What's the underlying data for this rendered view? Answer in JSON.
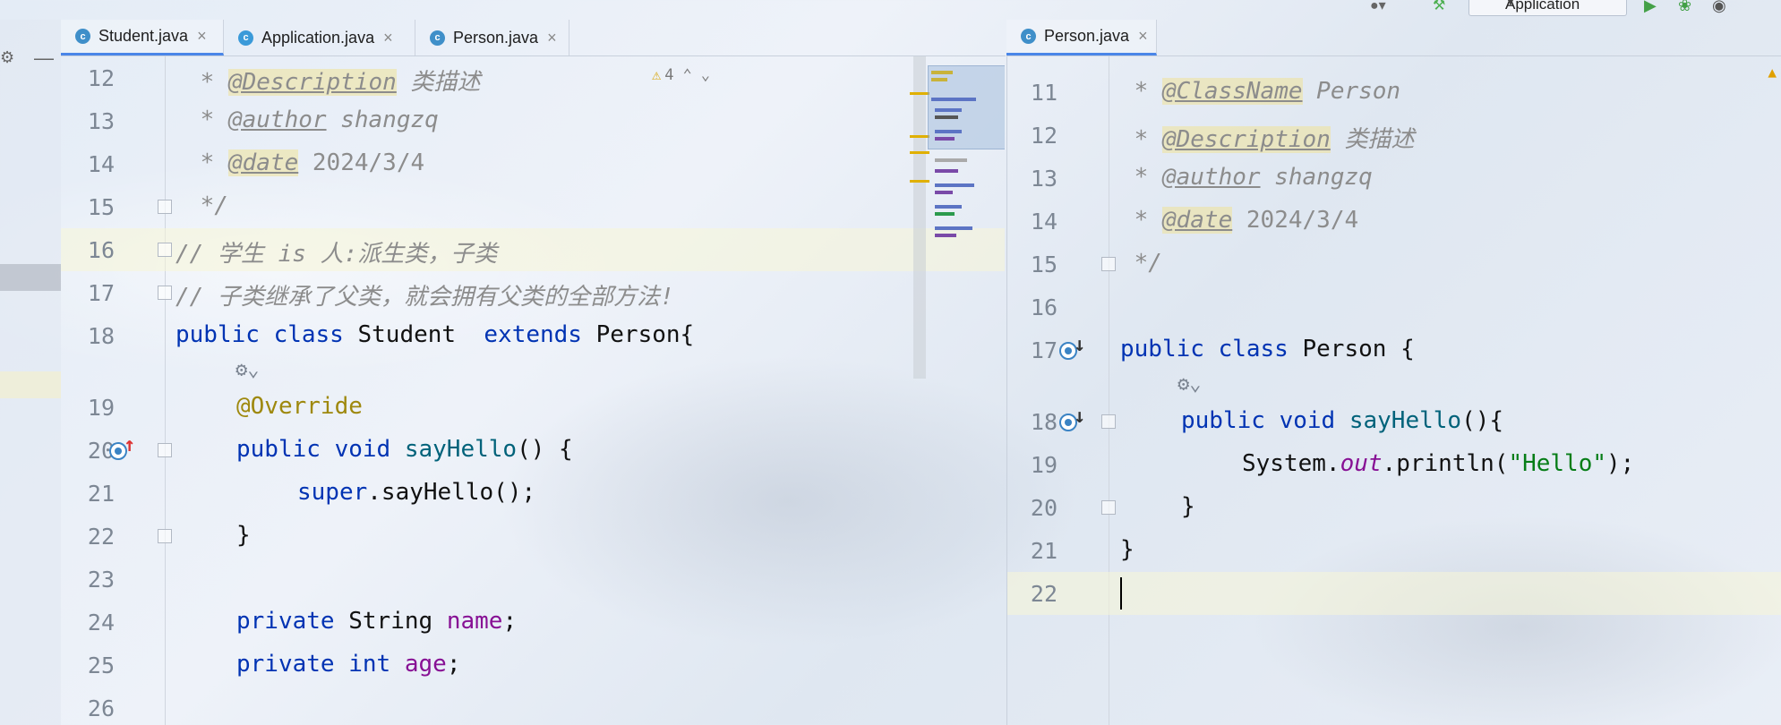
{
  "toolbar": {
    "run_config_label": "Application",
    "icons": [
      "user-icon",
      "hammer-icon",
      "run-icon",
      "debug-icon",
      "coverage-icon"
    ]
  },
  "left_pane": {
    "tabs": [
      {
        "label": "Student.java",
        "active": true,
        "icon": "class-icon"
      },
      {
        "label": "Application.java",
        "active": false,
        "icon": "main-class-icon"
      },
      {
        "label": "Person.java",
        "active": false,
        "icon": "class-icon"
      }
    ],
    "warning_count": "4",
    "lines": [
      {
        "n": "12",
        "text": " * @Description 类描述"
      },
      {
        "n": "13",
        "text": " * @author shangzq"
      },
      {
        "n": "14",
        "text": " * @date 2024/3/4"
      },
      {
        "n": "15",
        "text": " */"
      },
      {
        "n": "16",
        "text": "// 学生 is 人:派生类，子类"
      },
      {
        "n": "17",
        "text": "// 子类继承了父类，就会拥有父类的全部方法!"
      },
      {
        "n": "18",
        "text": "public class Student  extends Person{"
      },
      {
        "n": "19",
        "text": "    @Override"
      },
      {
        "n": "20",
        "text": "    public void sayHello() {"
      },
      {
        "n": "21",
        "text": "        super.sayHello();"
      },
      {
        "n": "22",
        "text": "    }"
      },
      {
        "n": "23",
        "text": ""
      },
      {
        "n": "24",
        "text": "    private String name;"
      },
      {
        "n": "25",
        "text": "    private int age;"
      },
      {
        "n": "26",
        "text": ""
      }
    ]
  },
  "right_pane": {
    "tabs": [
      {
        "label": "Person.java",
        "active": true,
        "icon": "class-icon"
      }
    ],
    "lines": [
      {
        "n": "11",
        "text": " * @ClassName Person"
      },
      {
        "n": "12",
        "text": " * @Description 类描述"
      },
      {
        "n": "13",
        "text": " * @author shangzq"
      },
      {
        "n": "14",
        "text": " * @date 2024/3/4"
      },
      {
        "n": "15",
        "text": " */"
      },
      {
        "n": "16",
        "text": ""
      },
      {
        "n": "17",
        "text": "public class Person {"
      },
      {
        "n": "18",
        "text": "    public void sayHello(){"
      },
      {
        "n": "19",
        "text": "        System.out.println(\"Hello\");"
      },
      {
        "n": "20",
        "text": "    }"
      },
      {
        "n": "21",
        "text": "}"
      },
      {
        "n": "22",
        "text": ""
      }
    ]
  }
}
